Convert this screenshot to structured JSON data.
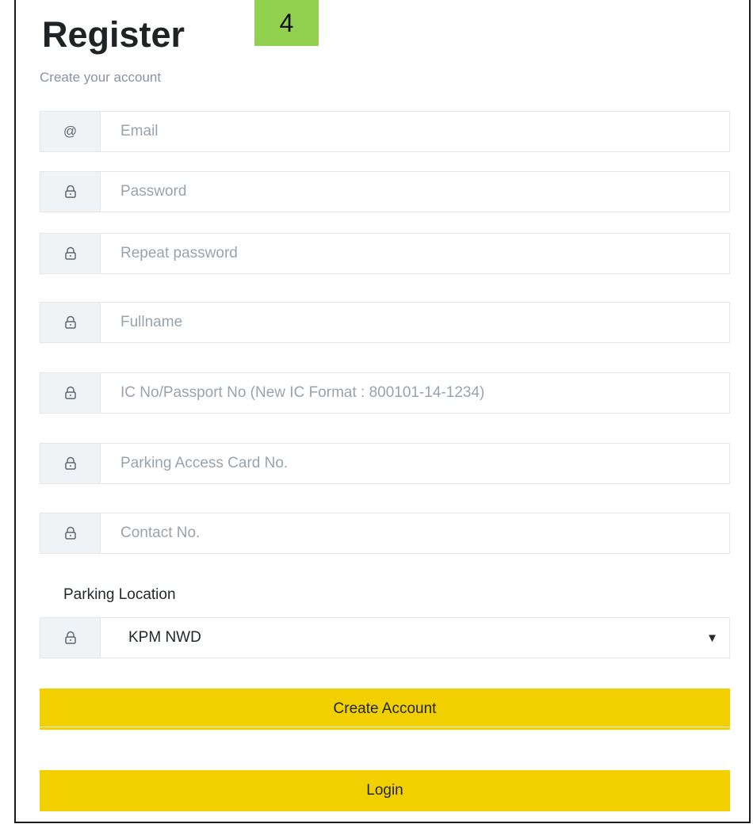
{
  "header": {
    "title": "Register",
    "step_badge": "4",
    "subtitle": "Create your account"
  },
  "form": {
    "fields": [
      {
        "id": "email",
        "icon": "at-icon",
        "placeholder": "Email",
        "value": ""
      },
      {
        "id": "password",
        "icon": "lock-icon",
        "placeholder": "Password",
        "value": ""
      },
      {
        "id": "repeat_password",
        "icon": "lock-icon",
        "placeholder": "Repeat password",
        "value": ""
      },
      {
        "id": "fullname",
        "icon": "lock-icon",
        "placeholder": "Fullname",
        "value": ""
      },
      {
        "id": "ic_passport",
        "icon": "lock-icon",
        "placeholder": "IC No/Passport No (New IC Format : 800101-14-1234)",
        "value": ""
      },
      {
        "id": "parking_card",
        "icon": "lock-icon",
        "placeholder": "Parking Access Card No.",
        "value": ""
      },
      {
        "id": "contact",
        "icon": "lock-icon",
        "placeholder": "Contact No.",
        "value": ""
      }
    ],
    "email_icon_glyph": "@",
    "location_label": "Parking Location",
    "location_selected": "KPM NWD",
    "location_caret": "▼"
  },
  "actions": {
    "create_account_label": "Create Account",
    "login_label": "Login"
  },
  "colors": {
    "button_bg": "#f2d000",
    "badge_bg": "#92d050",
    "addon_bg": "#f0f3f5",
    "border": "#e4e7ea",
    "placeholder": "#9aa3ad"
  }
}
